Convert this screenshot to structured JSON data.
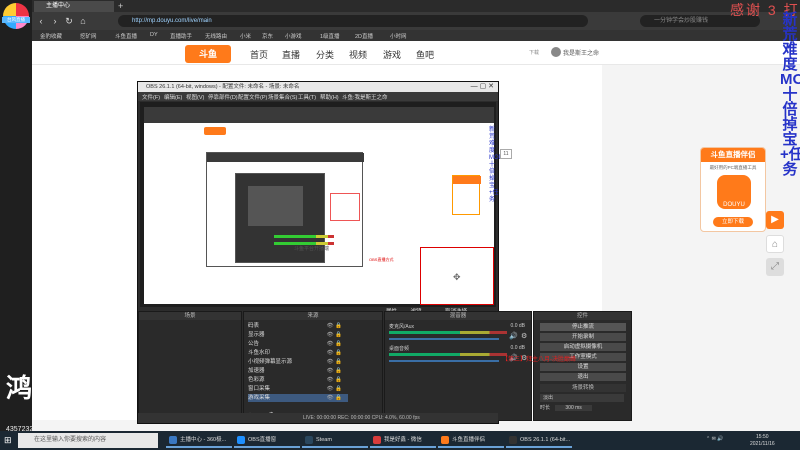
{
  "browser": {
    "tabs": [
      {
        "label": "主播中心"
      }
    ],
    "url": "http://mp.douyu.com/live/main",
    "search_placeholder": "一分钟学会炒股赚钱",
    "bookmarks": [
      "金豹收藏",
      "挖矿网",
      "斗鱼直播",
      "DY",
      "直播助手",
      "无线路由",
      "小米",
      "京东",
      "小游戏",
      "1级直播",
      "2D直播",
      "小时网"
    ]
  },
  "overlay": {
    "logo_label": "台风直播",
    "top_text": "感谢 3 打",
    "vertical_text": "新荒难度MOD十倍掉宝+任务",
    "big_mark": "鸿",
    "view_count": "4357232",
    "red_caption": "【第三】拜主八月-决胜巅峰"
  },
  "douyu": {
    "logo": "斗鱼",
    "nav": [
      "首页",
      "直播",
      "分类",
      "视频",
      "游戏",
      "鱼吧"
    ],
    "download": "下载",
    "user": "我是斯王之命"
  },
  "promo": {
    "title": "斗鱼直播伴侣",
    "subtitle": "最好用的PC端直播工具",
    "mascot": "DOUYU",
    "button": "立即下载"
  },
  "obs": {
    "title": "OBS 26.1.1 (64-bit, windows) - 配置文件: 未命名 - 场景: 未命名",
    "menu": [
      "文件(F)",
      "编辑(E)",
      "视图(V)",
      "停靠部件(D)",
      "配置文件(P)",
      "场景集合(S)",
      "工具(T)",
      "帮助(H)",
      "斗鱼:我是斯王之命"
    ],
    "preview": {
      "nested_label": "斗鱼平台开播端",
      "nested_red": "OBS直播方式",
      "tag": "11"
    },
    "docks": {
      "scenes": "场景",
      "sources": "来源",
      "mixer": "混音器",
      "controls": "控件"
    },
    "scene_tabs": [
      "场景",
      "来源"
    ],
    "properties_buttons": [
      "属性",
      "滤镜",
      "取消选择"
    ],
    "sources": [
      "码表",
      "显示器",
      "公告",
      "斗鱼水印",
      "小视频弹幕显示源",
      "加速器",
      "色彩源",
      "窗口采集",
      "游戏采集"
    ],
    "mixer": [
      {
        "name": "麦克风/Aux",
        "db": "0.0 dB"
      },
      {
        "name": "桌面音频",
        "db": "0.0 dB"
      }
    ],
    "controls": [
      "停止推流",
      "开始录制",
      "启动虚拟摄像机",
      "工作室模式",
      "设置",
      "退出"
    ],
    "transition": {
      "label": "场景转换",
      "type": "淡出",
      "duration_label": "时长",
      "duration": "300 ms"
    },
    "status": "LIVE: 00:00:00   REC: 00:00:00   CPU: 4.0%, 60.00 fps"
  },
  "taskbar": {
    "search_placeholder": "在这里输入你要搜索的内容",
    "apps": [
      "主播中心 - 360极...",
      "OBS直播窗",
      "Steam",
      "我是好鑫 - 微信",
      "斗鱼直播伴侣",
      "OBS 26.1.1 (64-bit..."
    ],
    "app_colors": [
      "#3a78c2",
      "#1e90ff",
      "#2a475e",
      "#d93c3c",
      "#ff7a1a",
      "#333333"
    ],
    "time": "15:50",
    "date": "2021/11/16"
  }
}
